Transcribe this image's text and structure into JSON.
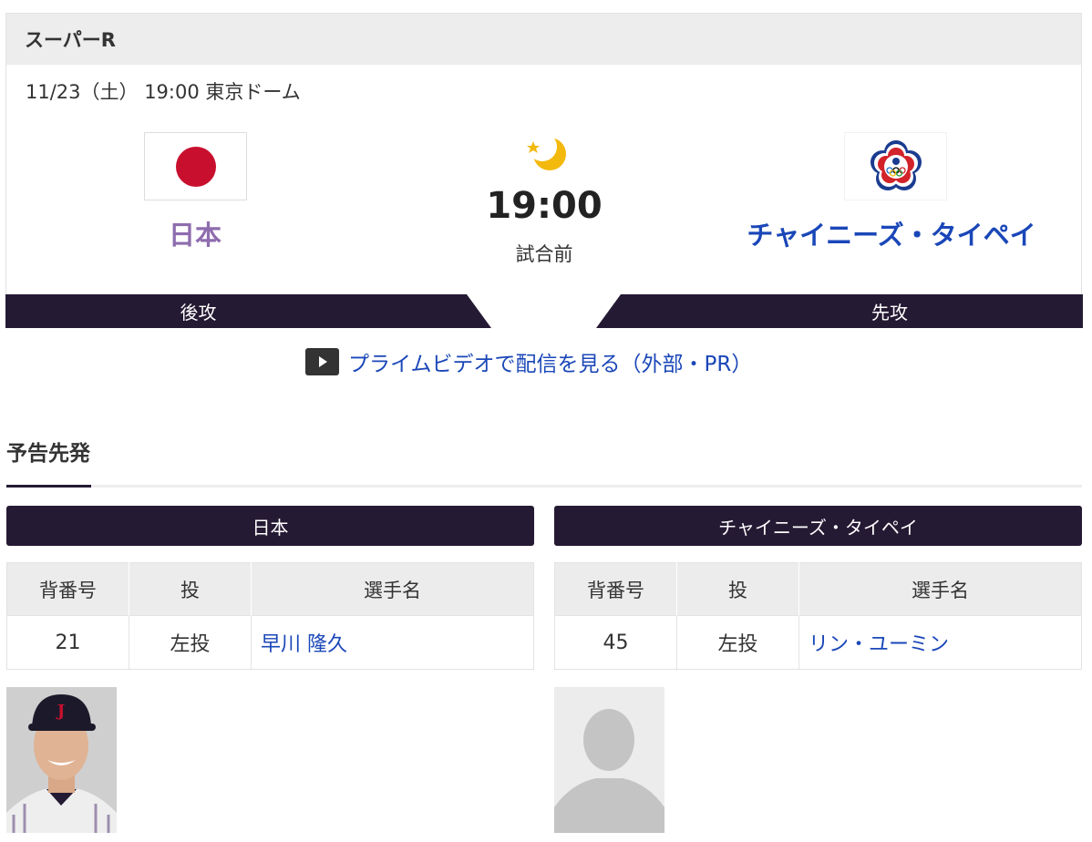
{
  "game": {
    "series_label": "スーパーR",
    "info": "11/23（土） 19:00 東京ドーム",
    "time": "19:00",
    "status": "試合前",
    "weather_icon": "moon-star-icon",
    "home_team": {
      "name": "日本",
      "flag_icon": "japan-flag-icon",
      "role": "後攻",
      "color": "#8e6cae"
    },
    "away_team": {
      "name": "チャイニーズ・タイペイ",
      "flag_icon": "chinese-taipei-flag-icon",
      "role": "先攻",
      "color": "#1a47b8"
    }
  },
  "stream": {
    "label": "プライムビデオで配信を見る（外部・PR）",
    "icon": "play-icon"
  },
  "section": {
    "title": "予告先発"
  },
  "table_headers": {
    "number": "背番号",
    "hand": "投",
    "player": "選手名"
  },
  "pitchers": [
    {
      "team": "日本",
      "number": "21",
      "hand": "左投",
      "name": "早川 隆久"
    },
    {
      "team": "チャイニーズ・タイペイ",
      "number": "45",
      "hand": "左投",
      "name": "リン・ユーミン"
    }
  ],
  "colors": {
    "dark_bar": "#251a33",
    "link": "#1a47b8",
    "home": "#8e6cae"
  }
}
